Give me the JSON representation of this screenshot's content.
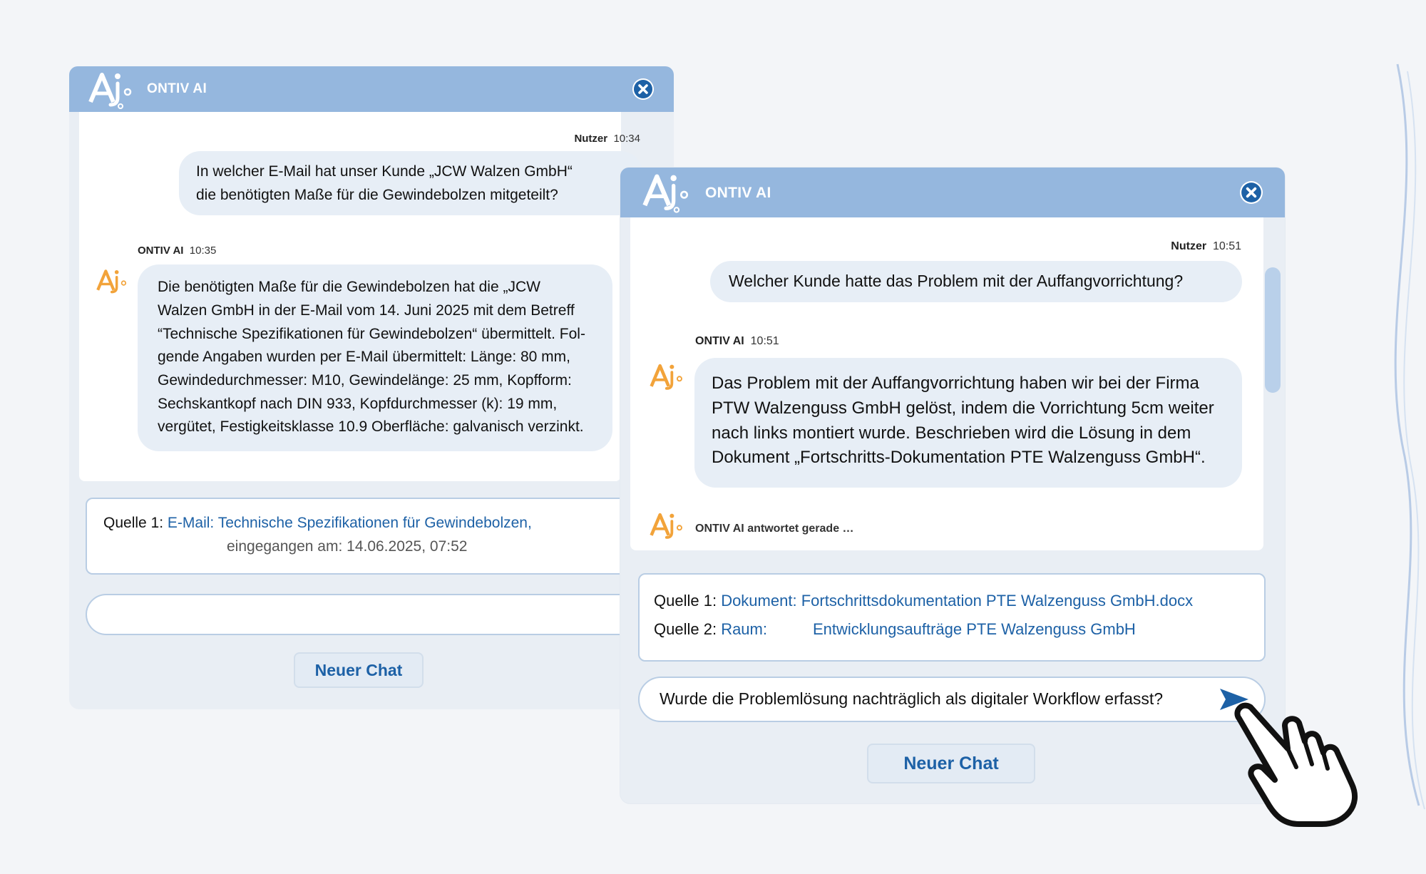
{
  "colors": {
    "header": "#95b7de",
    "bubble": "#e7eef6",
    "link": "#1d61a6",
    "accent_orange": "#f2a33a"
  },
  "win1": {
    "title": "ONTIV AI",
    "user_sender": "Nutzer",
    "user_time": "10:34",
    "user_line1": "In welcher E-Mail hat unser Kunde „JCW Walzen GmbH“",
    "user_line2": "die benötigten Maße für die Gewindebolzen mitgeteilt?",
    "ai_sender": "ONTIV AI",
    "ai_time": "10:35",
    "ai_lines": [
      "Die benötigten Maße für die Gewindebolzen hat die „JCW",
      "Walzen GmbH in der E-Mail vom 14. Juni 2025 mit dem Betreff",
      "“Technische Spezifikationen für Gewindebolzen“ übermittelt. Fol-",
      "gende Angaben wurden per E-Mail übermittelt: Länge: 80 mm,",
      "Gewindedurchmesser: M10, Gewindelänge: 25 mm, Kopfform:",
      "Sechskantkopf nach DIN 933, Kopfdurchmesser (k): 19 mm,",
      "vergütet, Festigkeitsklasse 10.9 Oberfläche: galvanisch verzinkt."
    ],
    "source_label": "Quelle 1:",
    "source_link": "E-Mail: Technische Spezifikationen für Gewindebolzen,",
    "source_received": "eingegangen am: 14.06.2025, 07:52",
    "input_value": "",
    "new_chat": "Neuer Chat"
  },
  "win2": {
    "title": "ONTIV AI",
    "user_sender": "Nutzer",
    "user_time": "10:51",
    "user_text": "Welcher Kunde hatte das Problem mit der Auffangvorrichtung?",
    "ai_sender": "ONTIV AI",
    "ai_time": "10:51",
    "ai_lines": [
      "Das Problem mit der Auffangvorrichtung haben wir bei der Firma",
      "PTW Walzenguss GmbH gelöst, indem die Vorrichtung 5cm weiter",
      "nach links montiert wurde. Beschrieben wird die Lösung in dem",
      "Dokument „Fortschritts-Dokumentation PTE Walzenguss GmbH“."
    ],
    "typing": "ONTIV AI antwortet gerade …",
    "source1_label": "Quelle 1:",
    "source1_type": "Dokument:",
    "source1_value": "Fortschrittsdokumentation PTE Walzenguss GmbH.docx",
    "source2_label": "Quelle 2:",
    "source2_type": "Raum:",
    "source2_value": "Entwicklungsaufträge PTE Walzenguss GmbH",
    "input_value": "Wurde die Problemlösung nachträglich als digitaler Workflow erfasst?",
    "new_chat": "Neuer Chat"
  }
}
